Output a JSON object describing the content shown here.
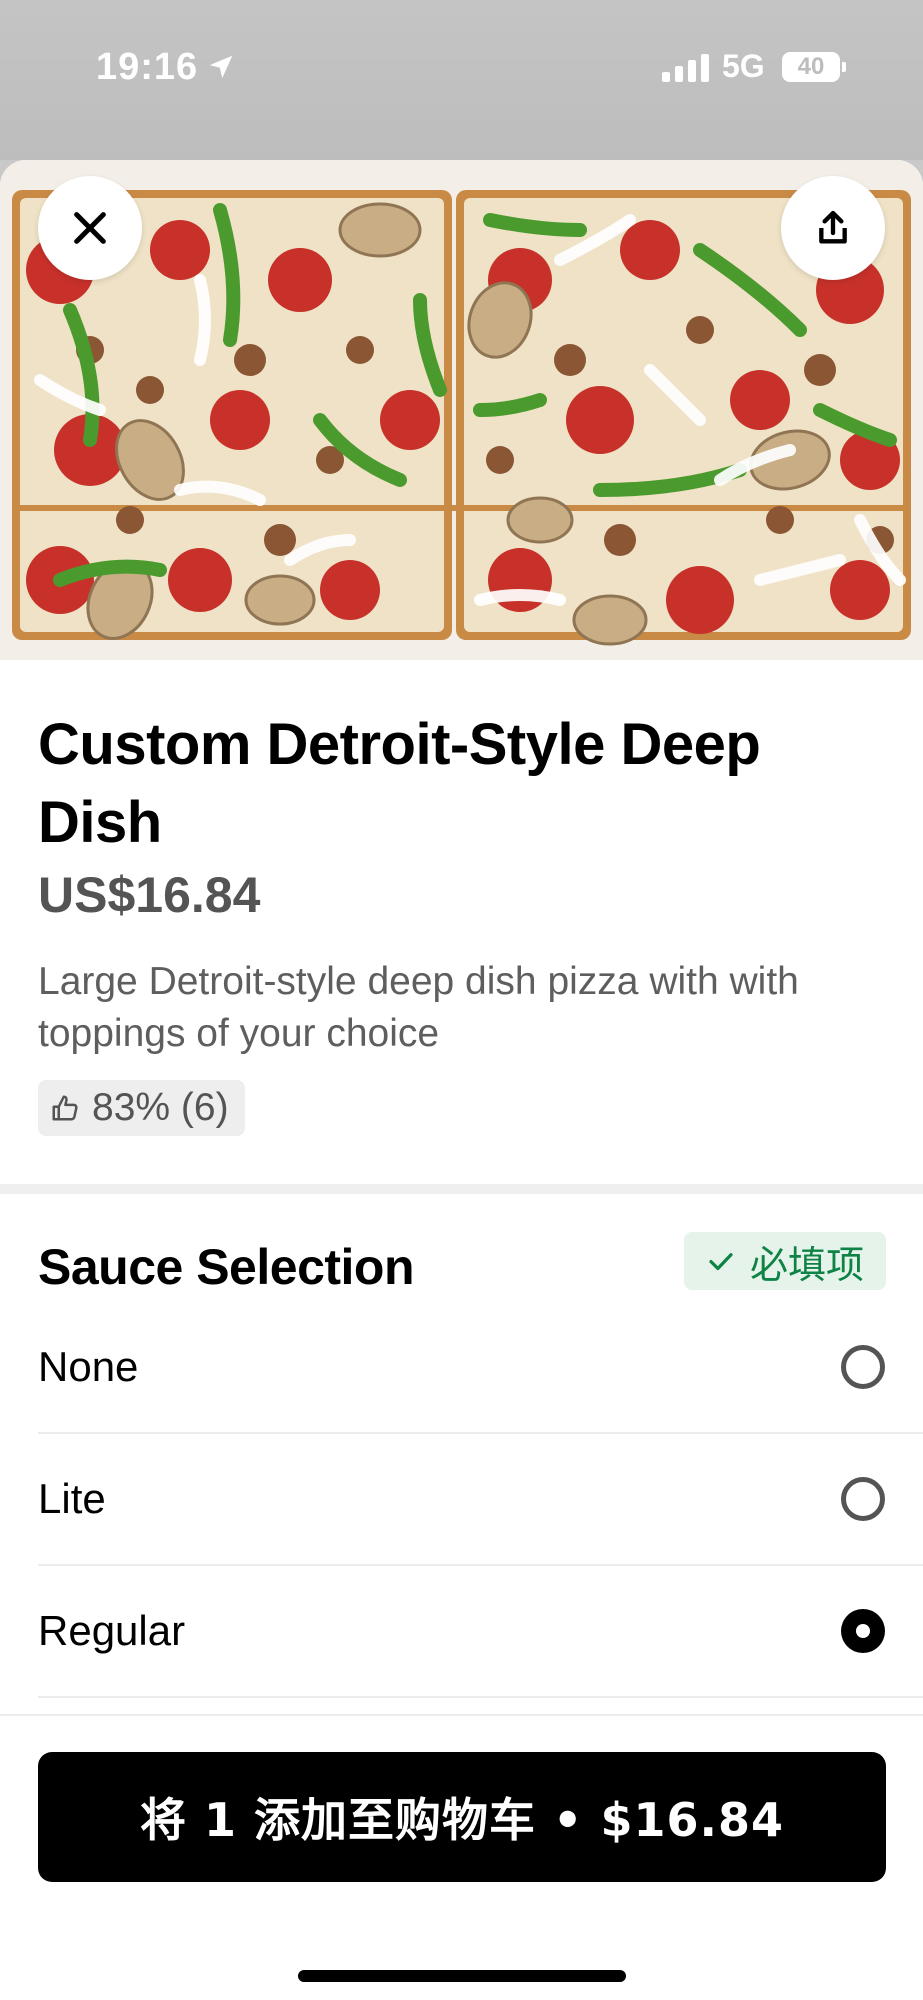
{
  "status_bar": {
    "time": "19:16",
    "network": "5G",
    "battery": "40",
    "icons": [
      "location-arrow-icon",
      "signal-icon",
      "battery-icon"
    ]
  },
  "item": {
    "title": "Custom Detroit-Style Deep Dish",
    "price": "US$16.84",
    "description": "Large Detroit-style deep dish pizza with with toppings of your choice",
    "rating": "83% (6)"
  },
  "sauce_section": {
    "title": "Sauce Selection",
    "required_label": "必填项",
    "options": [
      {
        "label": "None",
        "selected": false
      },
      {
        "label": "Lite",
        "selected": false
      },
      {
        "label": "Regular",
        "selected": true
      }
    ]
  },
  "cart_button": {
    "label": "将 1 添加至购物车 • $16.84"
  },
  "colors": {
    "accent_green": "#0e8345",
    "badge_bg": "#e6f3ea",
    "button_bg": "#000000",
    "price_gray": "#545454"
  }
}
